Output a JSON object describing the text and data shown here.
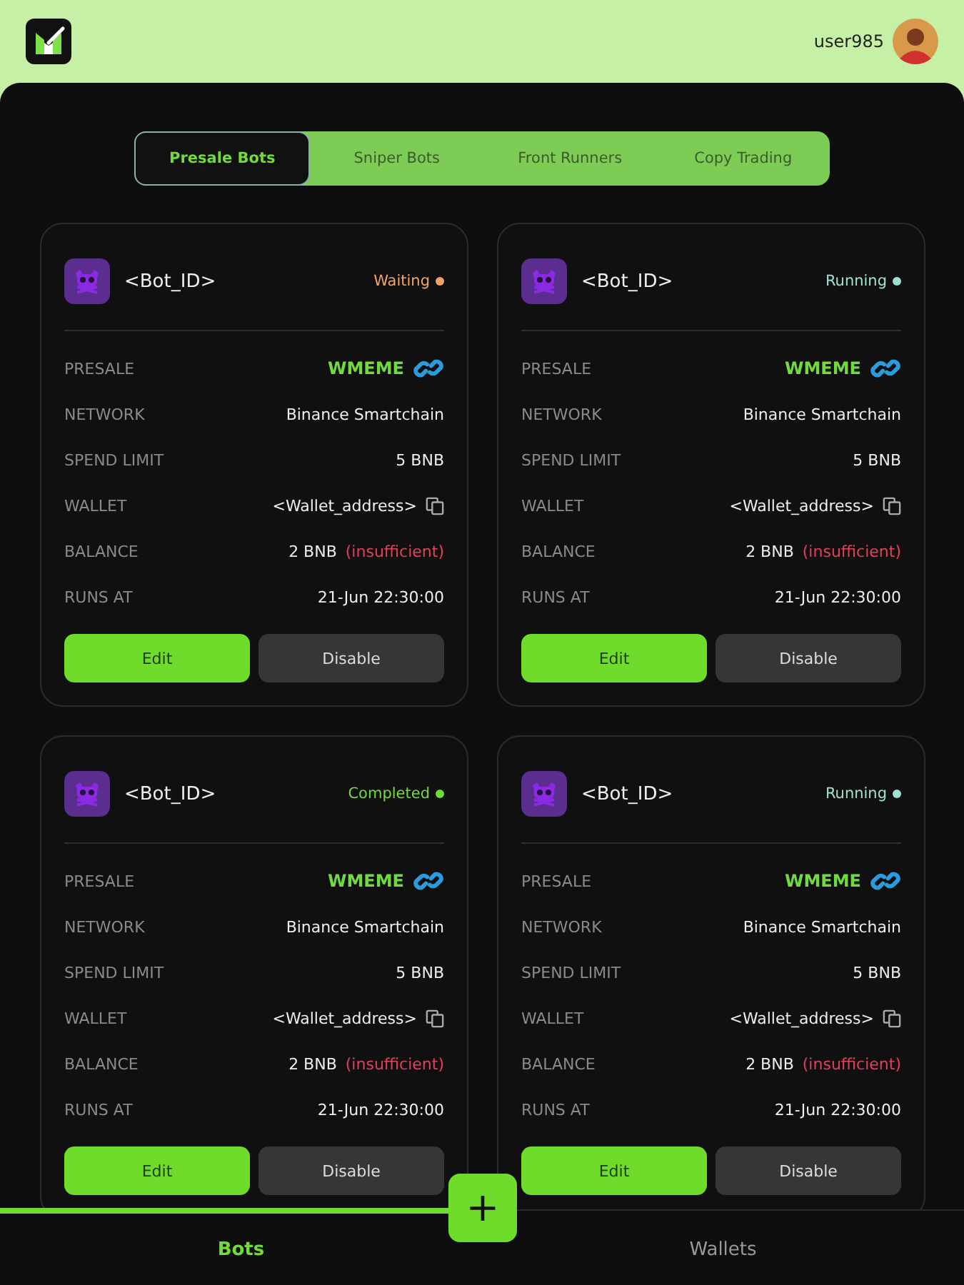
{
  "header": {
    "username": "user985"
  },
  "tabs": [
    {
      "label": "Presale Bots",
      "selected": true
    },
    {
      "label": "Sniper Bots",
      "selected": false
    },
    {
      "label": "Front Runners",
      "selected": false
    },
    {
      "label": "Copy Trading",
      "selected": false
    }
  ],
  "bots": [
    {
      "id": "<Bot_ID>",
      "status": "Waiting",
      "color": "#f2a46a",
      "rows": [
        {
          "kind": "link",
          "label": "PRESALE",
          "value": "WMEME"
        },
        {
          "kind": "text",
          "label": "NETWORK",
          "value": "Binance Smartchain"
        },
        {
          "kind": "text",
          "label": "SPEND LIMIT",
          "value": "5 BNB"
        },
        {
          "kind": "copy",
          "label": "WALLET",
          "value": "<Wallet_address>"
        },
        {
          "kind": "warn",
          "label": "BALANCE",
          "value": "2 BNB",
          "note": "(insufficient)"
        },
        {
          "kind": "text",
          "label": "RUNS AT",
          "value": "21-Jun 22:30:00"
        }
      ],
      "buttons": [
        "Edit",
        "Disable"
      ]
    },
    {
      "id": "<Bot_ID>",
      "status": "Running",
      "color": "#9ee0d2",
      "rows": [
        {
          "kind": "link",
          "label": "PRESALE",
          "value": "WMEME"
        },
        {
          "kind": "text",
          "label": "NETWORK",
          "value": "Binance Smartchain"
        },
        {
          "kind": "text",
          "label": "SPEND LIMIT",
          "value": "5 BNB"
        },
        {
          "kind": "copy",
          "label": "WALLET",
          "value": "<Wallet_address>"
        },
        {
          "kind": "warn",
          "label": "BALANCE",
          "value": "2 BNB",
          "note": "(insufficient)"
        },
        {
          "kind": "text",
          "label": "RUNS AT",
          "value": "21-Jun 22:30:00"
        }
      ],
      "buttons": [
        "Edit",
        "Disable"
      ]
    },
    {
      "id": "<Bot_ID>",
      "status": "Completed",
      "color": "#6fdc3a",
      "rows": [
        {
          "kind": "link",
          "label": "PRESALE",
          "value": "WMEME"
        },
        {
          "kind": "text",
          "label": "NETWORK",
          "value": "Binance Smartchain"
        },
        {
          "kind": "text",
          "label": "SPEND LIMIT",
          "value": "5 BNB"
        },
        {
          "kind": "copy",
          "label": "WALLET",
          "value": "<Wallet_address>"
        },
        {
          "kind": "warn",
          "label": "BALANCE",
          "value": "2 BNB",
          "note": "(insufficient)"
        },
        {
          "kind": "text",
          "label": "RUNS AT",
          "value": "21-Jun 22:30:00"
        }
      ],
      "buttons": [
        "Edit",
        "Disable"
      ]
    },
    {
      "id": "<Bot_ID>",
      "status": "Running",
      "color": "#9ee0d2",
      "rows": [
        {
          "kind": "link",
          "label": "PRESALE",
          "value": "WMEME"
        },
        {
          "kind": "text",
          "label": "NETWORK",
          "value": "Binance Smartchain"
        },
        {
          "kind": "text",
          "label": "SPEND LIMIT",
          "value": "5 BNB"
        },
        {
          "kind": "copy",
          "label": "WALLET",
          "value": "<Wallet_address>"
        },
        {
          "kind": "warn",
          "label": "BALANCE",
          "value": "2 BNB",
          "note": "(insufficient)"
        },
        {
          "kind": "text",
          "label": "RUNS AT",
          "value": "21-Jun 22:30:00"
        }
      ],
      "buttons": [
        "Edit",
        "Disable"
      ]
    }
  ],
  "add_button": {
    "label": "+"
  },
  "nav": [
    {
      "label": "Bots",
      "selected": true
    },
    {
      "label": "Wallets",
      "selected": false
    }
  ]
}
